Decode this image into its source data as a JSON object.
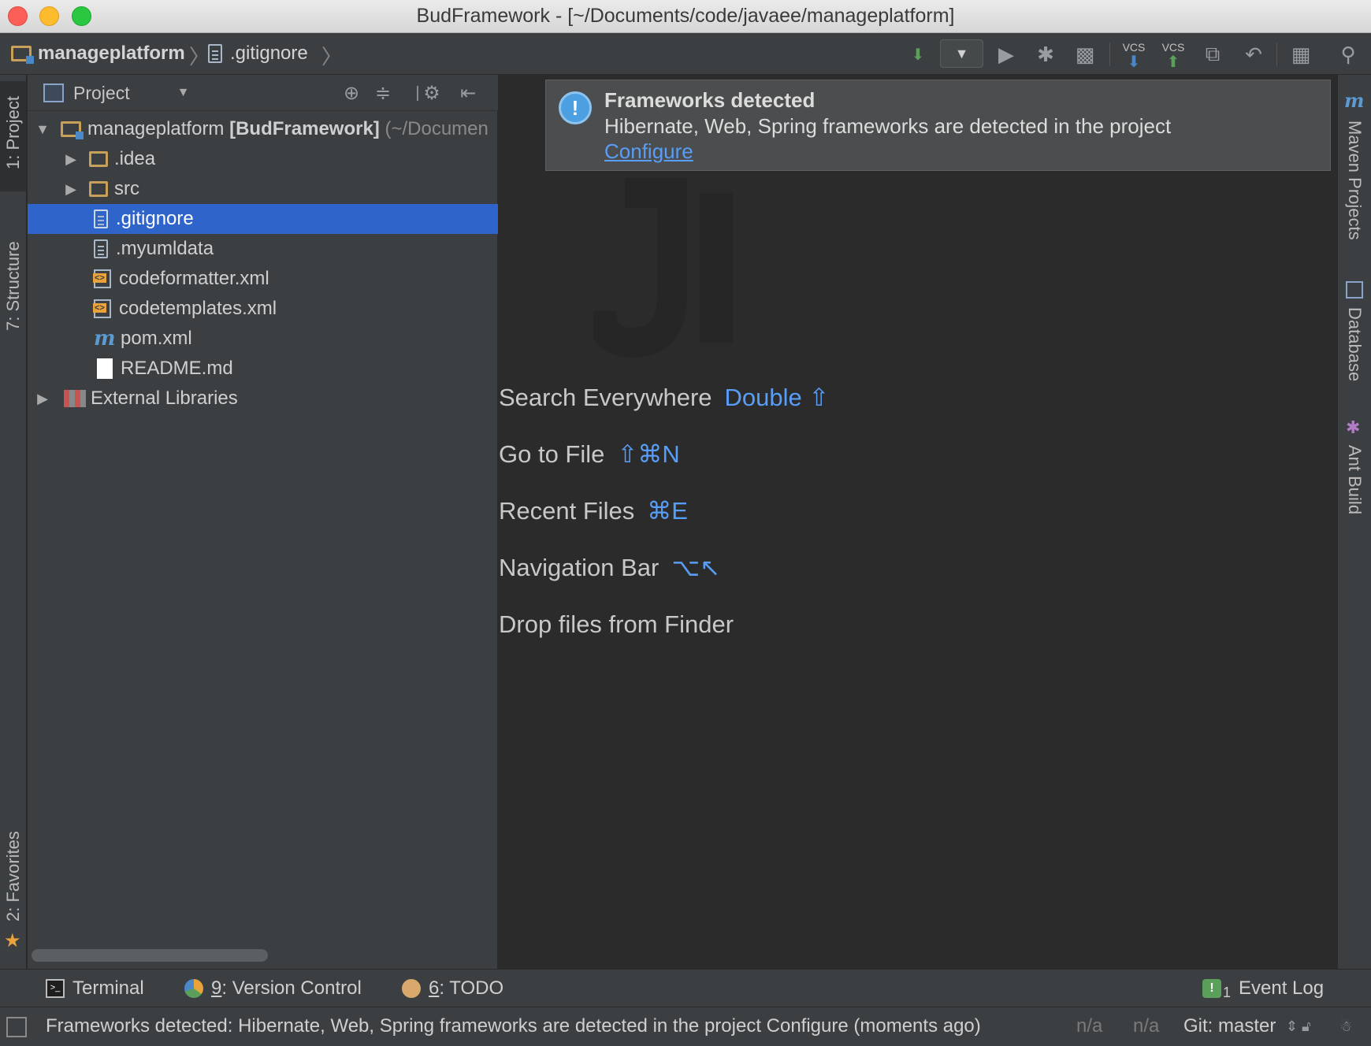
{
  "window": {
    "title": "BudFramework - [~/Documents/code/javaee/manageplatform]"
  },
  "navbar": {
    "crumb_project": "manageplatform",
    "crumb_file": ".gitignore",
    "vcs_update_label": "VCS",
    "vcs_commit_label": "VCS"
  },
  "left_tabs": {
    "project": "1: Project",
    "structure": "7: Structure",
    "favorites": "2: Favorites"
  },
  "right_tabs": {
    "maven": "Maven Projects",
    "database": "Database",
    "ant": "Ant Build"
  },
  "project_panel": {
    "title": "Project",
    "root": {
      "name": "manageplatform",
      "module": "[BudFramework]",
      "path": "(~/Documen"
    },
    "items": [
      {
        "name": ".idea",
        "type": "folder"
      },
      {
        "name": "src",
        "type": "folder"
      },
      {
        "name": ".gitignore",
        "type": "text",
        "selected": true
      },
      {
        "name": ".myumldata",
        "type": "text"
      },
      {
        "name": "codeformatter.xml",
        "type": "xml"
      },
      {
        "name": "codetemplates.xml",
        "type": "xml"
      },
      {
        "name": "pom.xml",
        "type": "maven"
      },
      {
        "name": "README.md",
        "type": "markdown"
      }
    ],
    "external_libraries": "External Libraries"
  },
  "notification": {
    "title": "Frameworks detected",
    "text": "Hibernate, Web, Spring frameworks are detected in the project",
    "link": "Configure"
  },
  "editor_hints": [
    {
      "label": "Search Everywhere",
      "key": "Double ⇧"
    },
    {
      "label": "Go to File",
      "key": "⇧⌘N"
    },
    {
      "label": "Recent Files",
      "key": "⌘E"
    },
    {
      "label": "Navigation Bar",
      "key": "⌥↖"
    },
    {
      "label": "Drop files from Finder",
      "key": ""
    }
  ],
  "tool_windows": {
    "terminal": "Terminal",
    "version_control_num": "9",
    "version_control": ": Version Control",
    "todo_num": "6",
    "todo": ": TODO",
    "event_log_count": "1",
    "event_log": "Event Log"
  },
  "status": {
    "message": "Frameworks detected: Hibernate, Web, Spring frameworks are detected in the project Configure (moments ago)",
    "na1": "n/a",
    "na2": "n/a",
    "git": "Git: master"
  }
}
